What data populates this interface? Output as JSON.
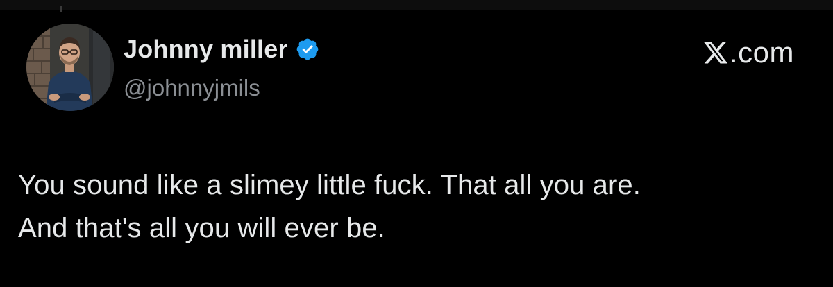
{
  "tweet": {
    "author": {
      "display_name": "Johnny miller",
      "handle": "@johnnyjmils",
      "verified": true,
      "verified_color": "#1d9bf0"
    },
    "brand": {
      "label": ".com",
      "icon": "x-logo-icon"
    },
    "text_lines": [
      "You sound like a slimey little fuck. That all you are.",
      "And that's all you will ever be."
    ]
  },
  "colors": {
    "background": "#000000",
    "primary_text": "#e7e9ea",
    "secondary_text": "#8b8f94"
  }
}
